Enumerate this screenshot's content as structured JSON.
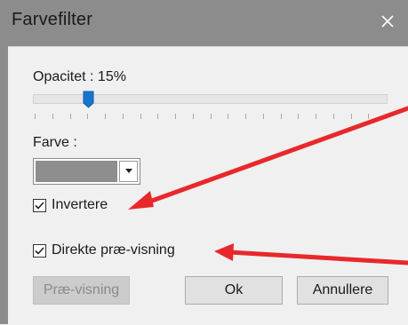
{
  "window": {
    "title": "Farvefilter",
    "close_icon": "close-icon"
  },
  "opacity": {
    "label": "Opacitet : 15%",
    "value_percent": 15
  },
  "color": {
    "label": "Farve :",
    "selected_color": "#8e8e8e"
  },
  "options": {
    "invert_label": "Invertere",
    "invert_checked": true,
    "live_preview_label": "Direkte præ-visning",
    "live_preview_checked": true
  },
  "buttons": {
    "preview_label": "Præ-visning",
    "preview_enabled": false,
    "ok_label": "Ok",
    "cancel_label": "Annullere"
  },
  "annotations": {
    "arrow_color": "#e8282b"
  }
}
